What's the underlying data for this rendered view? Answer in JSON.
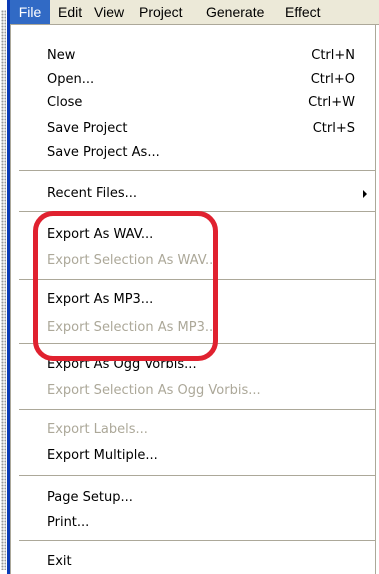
{
  "menubar": {
    "items": [
      "File",
      "Edit",
      "View",
      "Project",
      "Generate",
      "Effect"
    ]
  },
  "file_menu": {
    "new": {
      "label": "New",
      "shortcut": "Ctrl+N"
    },
    "open": {
      "label": "Open...",
      "shortcut": "Ctrl+O"
    },
    "close": {
      "label": "Close",
      "shortcut": "Ctrl+W"
    },
    "save_project": {
      "label": "Save Project",
      "shortcut": "Ctrl+S"
    },
    "save_project_as": {
      "label": "Save Project As..."
    },
    "recent_files": {
      "label": "Recent Files..."
    },
    "export_wav": {
      "label": "Export As WAV..."
    },
    "export_selection_wav": {
      "label": "Export Selection As WAV..."
    },
    "export_mp3": {
      "label": "Export As MP3..."
    },
    "export_selection_mp3": {
      "label": "Export Selection As MP3..."
    },
    "export_ogg": {
      "label": "Export As Ogg Vorbis..."
    },
    "export_selection_ogg": {
      "label": "Export Selection As Ogg Vorbis..."
    },
    "export_labels": {
      "label": "Export Labels..."
    },
    "export_multiple": {
      "label": "Export Multiple..."
    },
    "page_setup": {
      "label": "Page Setup..."
    },
    "print": {
      "label": "Print..."
    },
    "exit": {
      "label": "Exit"
    }
  },
  "colors": {
    "menubar_bg": "#ece9d8",
    "active_menu_bg": "#316ac5",
    "disabled_text": "#aca899",
    "annotation_red": "#e0212f"
  }
}
